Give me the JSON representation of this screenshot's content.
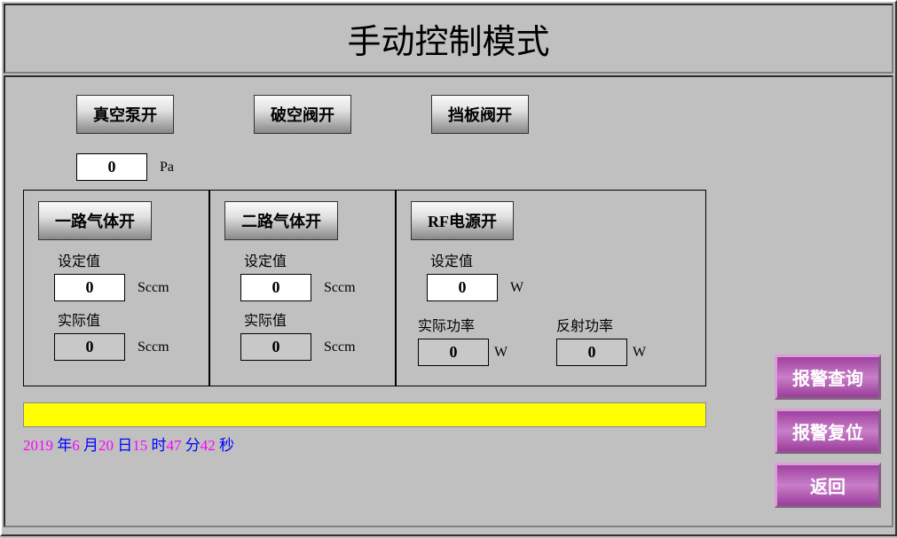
{
  "title": "手动控制模式",
  "top_buttons": {
    "vacuum_pump": "真空泵开",
    "vent_valve": "破空阀开",
    "baffle_valve": "挡板阀开"
  },
  "pressure": {
    "value": "0",
    "unit": "Pa"
  },
  "gas1": {
    "button": "一路气体开",
    "set_label": "设定值",
    "set_value": "0",
    "set_unit": "Sccm",
    "actual_label": "实际值",
    "actual_value": "0",
    "actual_unit": "Sccm"
  },
  "gas2": {
    "button": "二路气体开",
    "set_label": "设定值",
    "set_value": "0",
    "set_unit": "Sccm",
    "actual_label": "实际值",
    "actual_value": "0",
    "actual_unit": "Sccm"
  },
  "rf": {
    "button": "RF电源开",
    "set_label": "设定值",
    "set_value": "0",
    "set_unit": "W",
    "actual_power_label": "实际功率",
    "actual_power_value": "0",
    "actual_power_unit": "W",
    "reflect_power_label": "反射功率",
    "reflect_power_value": "0",
    "reflect_power_unit": "W"
  },
  "status_bar": "",
  "datetime": {
    "year": "2019",
    "year_l": "年",
    "month": "6",
    "month_l": "月",
    "day": "20",
    "day_l": "日",
    "hour": "15",
    "hour_l": "时",
    "minute": "47",
    "minute_l": "分",
    "second": "42",
    "second_l": "秒"
  },
  "side": {
    "alarm_query": "报警查询",
    "alarm_reset": "报警复位",
    "back": "返回"
  }
}
